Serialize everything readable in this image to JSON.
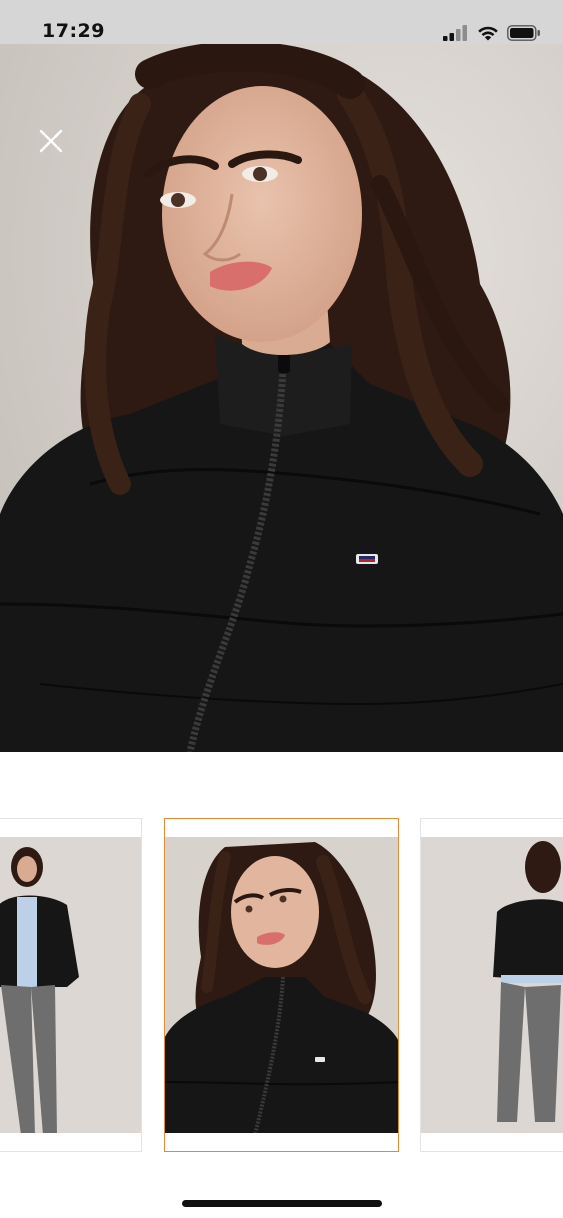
{
  "status_bar": {
    "time": "17:29",
    "icons": [
      "cellular-signal-icon",
      "wifi-icon",
      "battery-icon"
    ]
  },
  "viewer": {
    "close_icon": "close-icon",
    "images": [
      {
        "description": "model-full-length-front"
      },
      {
        "description": "model-closeup-front"
      },
      {
        "description": "model-full-length-back"
      }
    ],
    "selected_index": 1
  },
  "colors": {
    "selected_border": "#e38a3a",
    "jacket": "#161616",
    "backdrop": "#d8d2cc"
  }
}
